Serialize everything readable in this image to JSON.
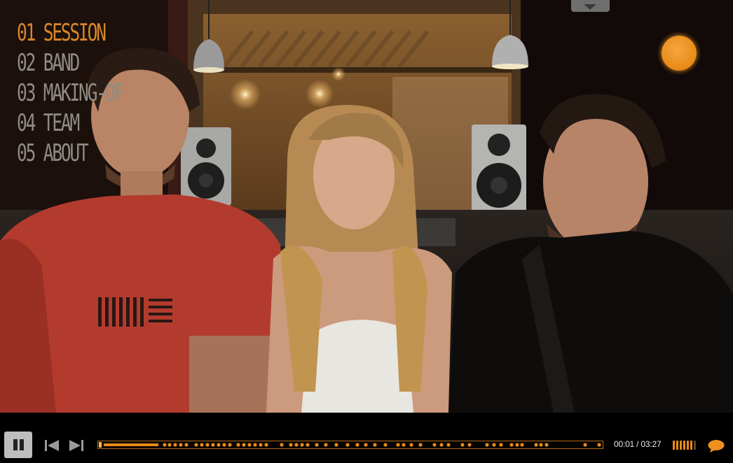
{
  "menu": {
    "items": [
      {
        "label": "01 SESSION",
        "active": true
      },
      {
        "label": "02 BAND",
        "active": false
      },
      {
        "label": "03 MAKING-OF",
        "active": false
      },
      {
        "label": "04 TEAM",
        "active": false
      },
      {
        "label": "05 ABOUT",
        "active": false
      }
    ]
  },
  "colors": {
    "accent": "#e88a16",
    "menu_active": "#d9862a",
    "menu_inactive": "#8f8c84"
  },
  "player": {
    "time_label": "00:01 / 03:27",
    "elapsed_seconds": 1,
    "duration_seconds": 207,
    "volume_level": 0.8,
    "icons": {
      "pause": "pause-icon",
      "previous": "skip-previous-icon",
      "next": "skip-next-icon",
      "volume": "volume-bars-icon",
      "chat": "speech-bubble-icon",
      "top_tab": "chevron-down-icon"
    }
  }
}
